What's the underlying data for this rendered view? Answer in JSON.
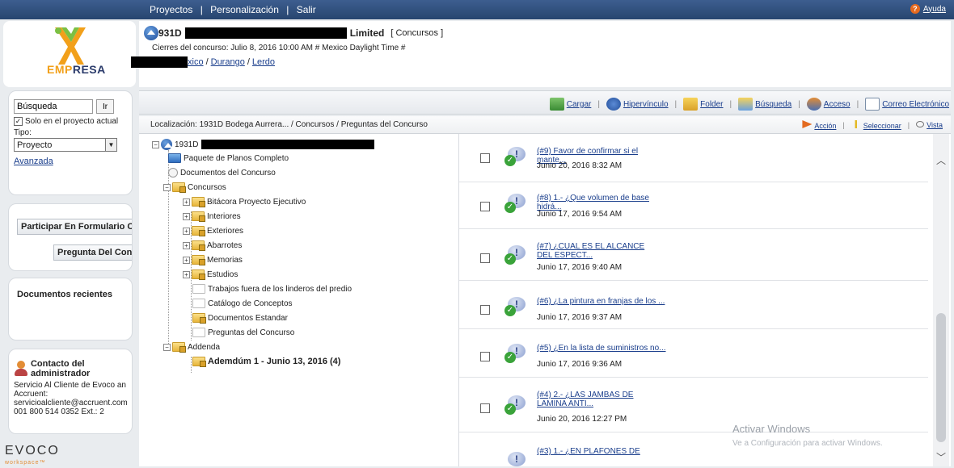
{
  "topnav": {
    "items": [
      "Proyectos",
      "Personalización",
      "Salir"
    ],
    "separator": "|",
    "help_label": "Ayuda"
  },
  "logo": {
    "part1": "EMP",
    "part2": "RESA"
  },
  "search": {
    "value": "Búsqueda",
    "go_label": "Ir",
    "only_current_label": "Solo en el proyecto actual",
    "tipo_label": "Tipo:",
    "tipo_value": "Proyecto",
    "advanced_label": "Avanzada"
  },
  "forms": {
    "participar_label": "Participar En Formulario Comp",
    "pregunta_label": "Pregunta Del Concurs"
  },
  "recent": {
    "title": "Documentos recientes"
  },
  "contact": {
    "title": "Contacto del administrador",
    "line1": "Servicio Al Cliente de Evoco an Accruent:",
    "email": "servicioalcliente@accruent.com",
    "phone": "001 800 514 0352 Ext.: 2"
  },
  "brand": {
    "name": "EVOCO",
    "tagline": "workspace™"
  },
  "header": {
    "project_code": "931D",
    "project_suffix": "Limited",
    "project_tag": "[ Concursos ]",
    "cierres": "Cierres del concurso: Julio 8, 2016 10:00 AM # Mexico Daylight Time #",
    "breadcrumb": [
      "xico",
      "Durango",
      "Lerdo"
    ],
    "breadcrumb_sep": "/"
  },
  "toolbar": {
    "items": [
      "Cargar",
      "Hipervínculo",
      "Folder",
      "Búsqueda",
      "Acceso",
      "Correo Electrónico"
    ]
  },
  "location": {
    "text": "Localización:  1931D Bodega Aurrera... / Concursos / Preguntas del Concurso",
    "actions": [
      "Acción",
      "Seleccionar",
      "Vista"
    ]
  },
  "tree": {
    "root": "1931D",
    "items": [
      "Paquete de Planos Completo",
      "Documentos del Concurso",
      "Concursos",
      "Bitácora Proyecto Ejecutivo",
      "Interiores",
      "Exteriores",
      "Abarrotes",
      "Memorias",
      "Estudios",
      "Trabajos fuera de los linderos del predio",
      "Catálogo de Conceptos",
      "Documentos Estandar",
      "Preguntas del Concurso",
      "Addenda",
      "Ademdúm 1 - Junio 13, 2016 (4)"
    ]
  },
  "questions": [
    {
      "title": "(#9) Favor de confirmar si el mante...",
      "date": "Junio 20, 2016 8:32 AM"
    },
    {
      "title": "(#8) 1.- ¿Que volumen de base hidrá...",
      "date": "Junio 17, 2016 9:54 AM"
    },
    {
      "title": "(#7) ¿CUAL ES EL ALCANCE DEL ESPECT...",
      "date": "Junio 17, 2016 9:40 AM"
    },
    {
      "title": "(#6) ¿La pintura en franjas de los ...",
      "date": "Junio 17, 2016 9:37 AM"
    },
    {
      "title": "(#5) ¿En la lista de suministros no...",
      "date": "Junio 17, 2016 9:36 AM"
    },
    {
      "title": "(#4) 2.- ¿LAS JAMBAS DE LAMINA ANTI...",
      "date": "Junio 20, 2016 12:27 PM"
    },
    {
      "title": "(#3) 1.- ¿EN PLAFONES DE",
      "date": ""
    }
  ],
  "watermark": {
    "line1": "Activar Windows",
    "line2": "Ve a Configuración para activar Windows."
  }
}
